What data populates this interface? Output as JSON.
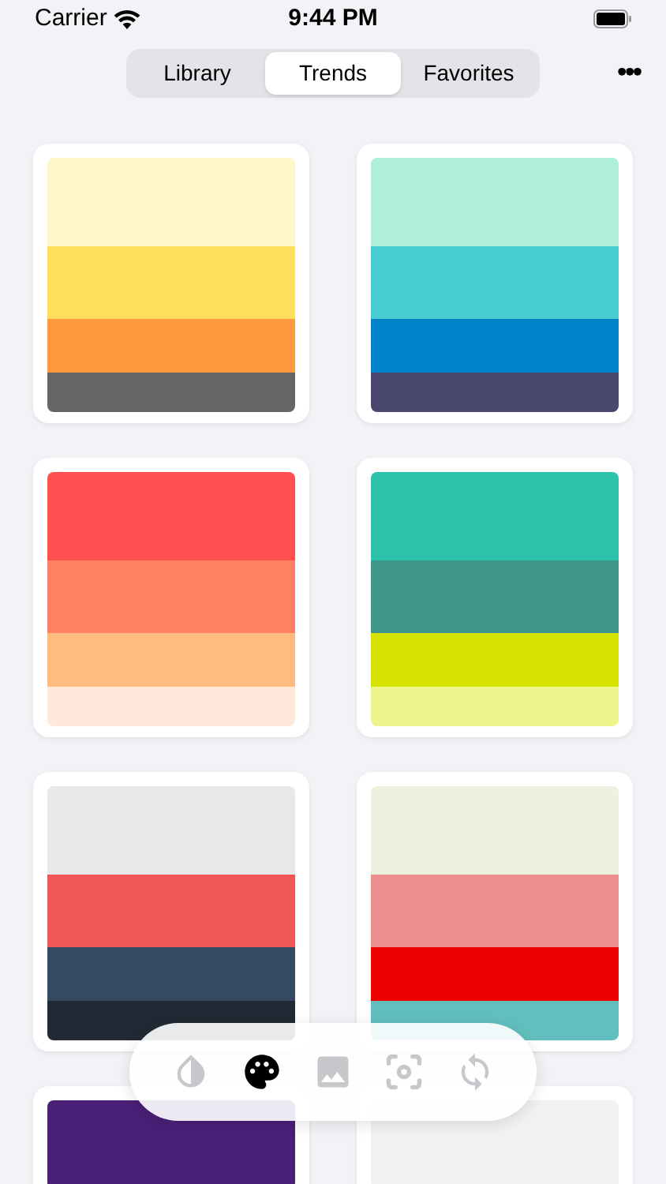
{
  "status_bar": {
    "carrier": "Carrier",
    "time": "9:44 PM"
  },
  "tabs": [
    {
      "label": "Library",
      "selected": false
    },
    {
      "label": "Trends",
      "selected": true
    },
    {
      "label": "Favorites",
      "selected": false
    }
  ],
  "more_button": "•••",
  "palettes": [
    {
      "stripes": [
        {
          "color": "#fff7cc"
        },
        {
          "color": "#ffde5c"
        },
        {
          "color": "#ff9a40"
        },
        {
          "color": "#666666"
        }
      ]
    },
    {
      "stripes": [
        {
          "color": "#aeeeda"
        },
        {
          "color": "#48cdd1"
        },
        {
          "color": "#0082c8"
        },
        {
          "color": "#4a476f"
        }
      ]
    },
    {
      "stripes": [
        {
          "color": "#ff4f4f"
        },
        {
          "color": "#ff8163"
        },
        {
          "color": "#ffbb80"
        },
        {
          "color": "#ffe9da"
        }
      ]
    },
    {
      "stripes": [
        {
          "color": "#2dc2ab"
        },
        {
          "color": "#3f978a"
        },
        {
          "color": "#d6e300"
        },
        {
          "color": "#eef58c"
        }
      ]
    },
    {
      "stripes": [
        {
          "color": "#e8e8e8"
        },
        {
          "color": "#f05558"
        },
        {
          "color": "#344a62"
        },
        {
          "color": "#212a34"
        }
      ]
    },
    {
      "stripes": [
        {
          "color": "#eff1e0"
        },
        {
          "color": "#ea8f8e"
        },
        {
          "color": "#ef0000"
        },
        {
          "color": "#63bfbf"
        }
      ]
    },
    {
      "stripes": [
        {
          "color": "#4a2078"
        }
      ]
    },
    {
      "stripes": [
        {
          "color": "#f2f2f2"
        }
      ]
    }
  ],
  "toolbar": [
    {
      "kind": "contrast",
      "selected": false
    },
    {
      "kind": "palette",
      "selected": true
    },
    {
      "kind": "image",
      "selected": false
    },
    {
      "kind": "focus",
      "selected": false
    },
    {
      "kind": "refresh",
      "selected": false
    }
  ]
}
